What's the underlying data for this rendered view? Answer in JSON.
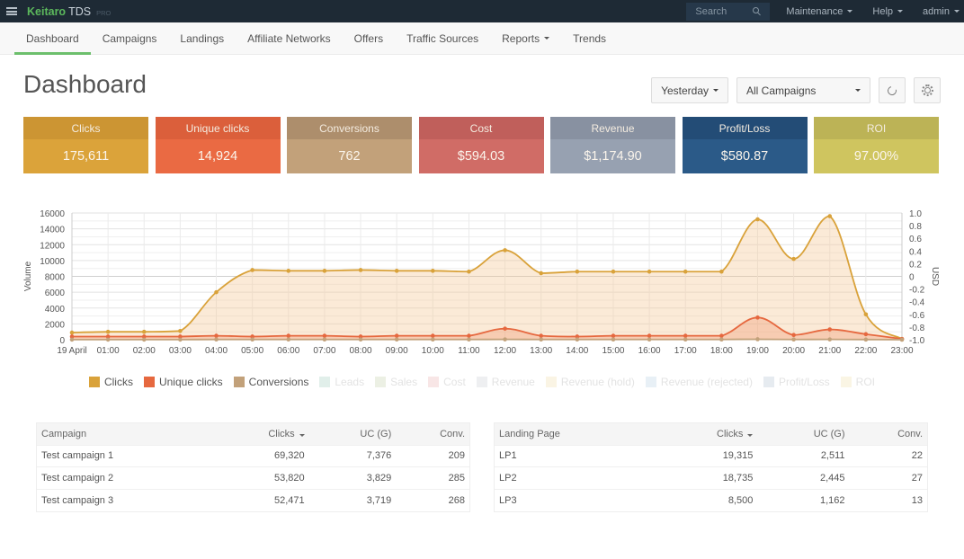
{
  "topbar": {
    "brand_main": "Keitaro",
    "brand_tds": "TDS",
    "brand_edition": "PRO",
    "search_placeholder": "Search",
    "menus": [
      "Maintenance",
      "Help",
      "admin"
    ]
  },
  "nav": {
    "items": [
      {
        "label": "Dashboard",
        "active": true
      },
      {
        "label": "Campaigns"
      },
      {
        "label": "Landings"
      },
      {
        "label": "Affiliate Networks"
      },
      {
        "label": "Offers"
      },
      {
        "label": "Traffic Sources"
      },
      {
        "label": "Reports",
        "dropdown": true
      },
      {
        "label": "Trends"
      }
    ]
  },
  "header": {
    "title": "Dashboard",
    "period": "Yesterday",
    "campaign_filter": "All Campaigns",
    "refresh_icon": "refresh-icon",
    "settings_icon": "gear-icon"
  },
  "cards": [
    {
      "label": "Clicks",
      "value": "175,611",
      "head": "#cc9533",
      "body": "#dba33a"
    },
    {
      "label": "Unique clicks",
      "value": "14,924",
      "head": "#db5f3b",
      "body": "#ea6a43"
    },
    {
      "label": "Conversions",
      "value": "762",
      "head": "#ad8e6c",
      "body": "#c2a17a"
    },
    {
      "label": "Cost",
      "value": "$594.03",
      "head": "#c05f5b",
      "body": "#d06c66"
    },
    {
      "label": "Revenue",
      "value": "$1,174.90",
      "head": "#8891a1",
      "body": "#97a1b1"
    },
    {
      "label": "Profit/Loss",
      "value": "$580.87",
      "head": "#234c76",
      "body": "#2b5a88"
    },
    {
      "label": "ROI",
      "value": "97.00%",
      "head": "#bcb356",
      "body": "#cfc55f"
    }
  ],
  "chart_data": {
    "type": "area",
    "x": [
      "19 April",
      "01:00",
      "02:00",
      "03:00",
      "04:00",
      "05:00",
      "06:00",
      "07:00",
      "08:00",
      "09:00",
      "10:00",
      "11:00",
      "12:00",
      "13:00",
      "14:00",
      "15:00",
      "16:00",
      "17:00",
      "18:00",
      "19:00",
      "20:00",
      "21:00",
      "22:00",
      "23:00"
    ],
    "ylabel": "Volume",
    "ylabel_right": "USD",
    "ylim": [
      0,
      16000
    ],
    "yticks": [
      0,
      2000,
      4000,
      6000,
      8000,
      10000,
      12000,
      14000,
      16000
    ],
    "ylim_right": [
      -1.0,
      1.0
    ],
    "yticks_right": [
      "-1.0",
      "-0.8",
      "-0.6",
      "-0.4",
      "-0.2",
      "0",
      "0.2",
      "0.4",
      "0.6",
      "0.8",
      "1.0"
    ],
    "grid": true,
    "legend_position": "bottom",
    "series": [
      {
        "name": "Clicks",
        "color": "#d9a23a",
        "visible": true,
        "values": [
          900,
          1000,
          1000,
          1100,
          6000,
          8800,
          8700,
          8700,
          8800,
          8700,
          8700,
          8600,
          11300,
          8400,
          8600,
          8600,
          8600,
          8600,
          8600,
          15200,
          10200,
          15600,
          3200,
          100
        ]
      },
      {
        "name": "Unique clicks",
        "color": "#e6683f",
        "visible": true,
        "values": [
          400,
          400,
          400,
          400,
          500,
          400,
          500,
          500,
          400,
          500,
          500,
          500,
          1400,
          500,
          400,
          500,
          500,
          500,
          500,
          2800,
          600,
          1300,
          700,
          100
        ]
      },
      {
        "name": "Conversions",
        "color": "#c2a17a",
        "visible": true,
        "values": [
          10,
          10,
          10,
          10,
          30,
          30,
          30,
          30,
          30,
          30,
          30,
          30,
          40,
          30,
          30,
          30,
          30,
          30,
          30,
          60,
          30,
          40,
          20,
          5
        ]
      },
      {
        "name": "Leads",
        "color": "#cde5dc",
        "visible": false
      },
      {
        "name": "Sales",
        "color": "#dfe6d2",
        "visible": false
      },
      {
        "name": "Cost",
        "color": "#f3d5d5",
        "visible": false
      },
      {
        "name": "Revenue",
        "color": "#e2e4e8",
        "visible": false
      },
      {
        "name": "Revenue (hold)",
        "color": "#f6ecd2",
        "visible": false
      },
      {
        "name": "Revenue (rejected)",
        "color": "#d9e6f0",
        "visible": false
      },
      {
        "name": "Profit/Loss",
        "color": "#d6dde6",
        "visible": false
      },
      {
        "name": "ROI",
        "color": "#f6efd2",
        "visible": false
      }
    ]
  },
  "campaigns_table": {
    "columns": [
      "Campaign",
      "Clicks",
      "UC (G)",
      "Conv."
    ],
    "sorted_column": "Clicks",
    "rows": [
      [
        "Test campaign 1",
        "69,320",
        "7,376",
        "209"
      ],
      [
        "Test campaign 2",
        "53,820",
        "3,829",
        "285"
      ],
      [
        "Test campaign 3",
        "52,471",
        "3,719",
        "268"
      ]
    ]
  },
  "landings_table": {
    "columns": [
      "Landing Page",
      "Clicks",
      "UC (G)",
      "Conv."
    ],
    "sorted_column": "Clicks",
    "rows": [
      [
        "LP1",
        "19,315",
        "2,511",
        "22"
      ],
      [
        "LP2",
        "18,735",
        "2,445",
        "27"
      ],
      [
        "LP3",
        "8,500",
        "1,162",
        "13"
      ]
    ]
  }
}
